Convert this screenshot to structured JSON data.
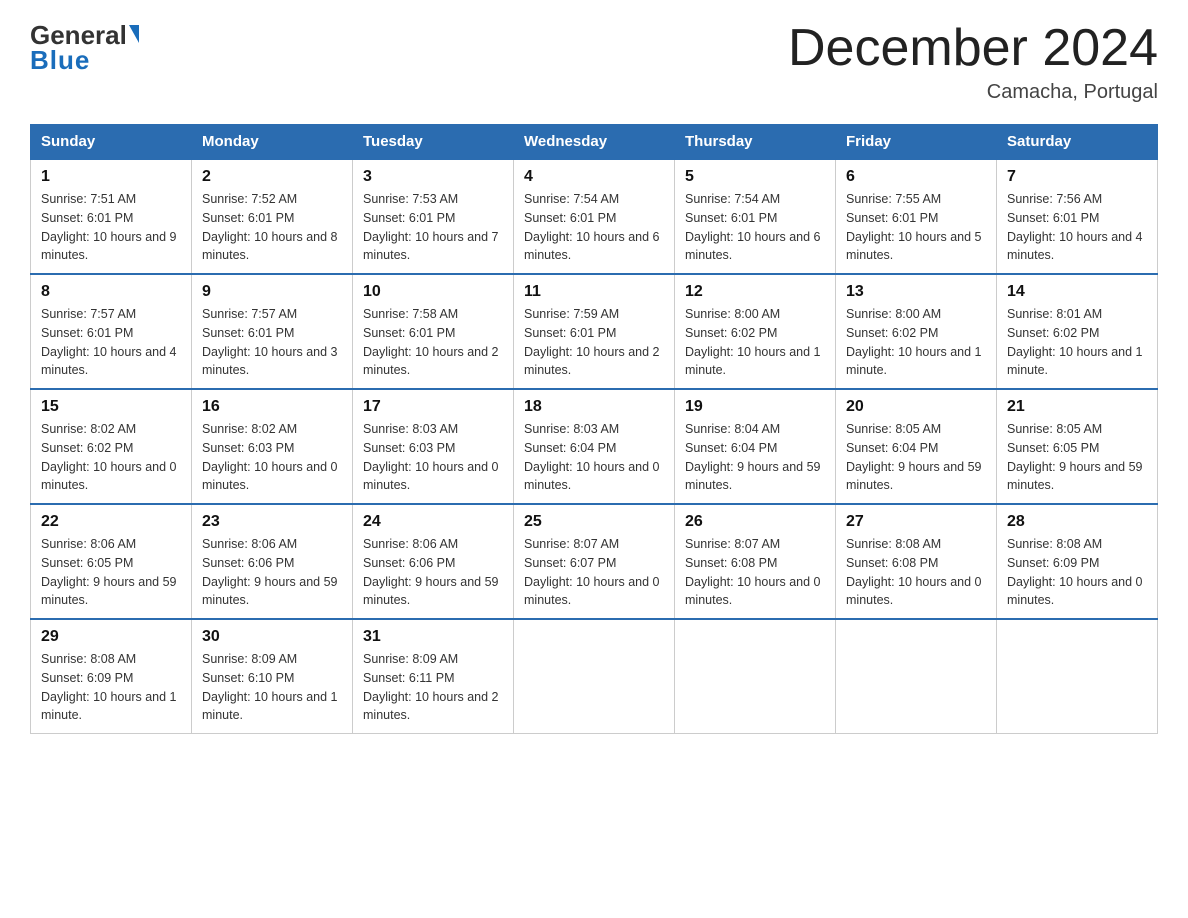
{
  "logo": {
    "general": "General",
    "blue": "Blue"
  },
  "header": {
    "title": "December 2024",
    "subtitle": "Camacha, Portugal"
  },
  "days_of_week": [
    "Sunday",
    "Monday",
    "Tuesday",
    "Wednesday",
    "Thursday",
    "Friday",
    "Saturday"
  ],
  "weeks": [
    [
      {
        "day": "1",
        "sunrise": "7:51 AM",
        "sunset": "6:01 PM",
        "daylight": "10 hours and 9 minutes."
      },
      {
        "day": "2",
        "sunrise": "7:52 AM",
        "sunset": "6:01 PM",
        "daylight": "10 hours and 8 minutes."
      },
      {
        "day": "3",
        "sunrise": "7:53 AM",
        "sunset": "6:01 PM",
        "daylight": "10 hours and 7 minutes."
      },
      {
        "day": "4",
        "sunrise": "7:54 AM",
        "sunset": "6:01 PM",
        "daylight": "10 hours and 6 minutes."
      },
      {
        "day": "5",
        "sunrise": "7:54 AM",
        "sunset": "6:01 PM",
        "daylight": "10 hours and 6 minutes."
      },
      {
        "day": "6",
        "sunrise": "7:55 AM",
        "sunset": "6:01 PM",
        "daylight": "10 hours and 5 minutes."
      },
      {
        "day": "7",
        "sunrise": "7:56 AM",
        "sunset": "6:01 PM",
        "daylight": "10 hours and 4 minutes."
      }
    ],
    [
      {
        "day": "8",
        "sunrise": "7:57 AM",
        "sunset": "6:01 PM",
        "daylight": "10 hours and 4 minutes."
      },
      {
        "day": "9",
        "sunrise": "7:57 AM",
        "sunset": "6:01 PM",
        "daylight": "10 hours and 3 minutes."
      },
      {
        "day": "10",
        "sunrise": "7:58 AM",
        "sunset": "6:01 PM",
        "daylight": "10 hours and 2 minutes."
      },
      {
        "day": "11",
        "sunrise": "7:59 AM",
        "sunset": "6:01 PM",
        "daylight": "10 hours and 2 minutes."
      },
      {
        "day": "12",
        "sunrise": "8:00 AM",
        "sunset": "6:02 PM",
        "daylight": "10 hours and 1 minute."
      },
      {
        "day": "13",
        "sunrise": "8:00 AM",
        "sunset": "6:02 PM",
        "daylight": "10 hours and 1 minute."
      },
      {
        "day": "14",
        "sunrise": "8:01 AM",
        "sunset": "6:02 PM",
        "daylight": "10 hours and 1 minute."
      }
    ],
    [
      {
        "day": "15",
        "sunrise": "8:02 AM",
        "sunset": "6:02 PM",
        "daylight": "10 hours and 0 minutes."
      },
      {
        "day": "16",
        "sunrise": "8:02 AM",
        "sunset": "6:03 PM",
        "daylight": "10 hours and 0 minutes."
      },
      {
        "day": "17",
        "sunrise": "8:03 AM",
        "sunset": "6:03 PM",
        "daylight": "10 hours and 0 minutes."
      },
      {
        "day": "18",
        "sunrise": "8:03 AM",
        "sunset": "6:04 PM",
        "daylight": "10 hours and 0 minutes."
      },
      {
        "day": "19",
        "sunrise": "8:04 AM",
        "sunset": "6:04 PM",
        "daylight": "9 hours and 59 minutes."
      },
      {
        "day": "20",
        "sunrise": "8:05 AM",
        "sunset": "6:04 PM",
        "daylight": "9 hours and 59 minutes."
      },
      {
        "day": "21",
        "sunrise": "8:05 AM",
        "sunset": "6:05 PM",
        "daylight": "9 hours and 59 minutes."
      }
    ],
    [
      {
        "day": "22",
        "sunrise": "8:06 AM",
        "sunset": "6:05 PM",
        "daylight": "9 hours and 59 minutes."
      },
      {
        "day": "23",
        "sunrise": "8:06 AM",
        "sunset": "6:06 PM",
        "daylight": "9 hours and 59 minutes."
      },
      {
        "day": "24",
        "sunrise": "8:06 AM",
        "sunset": "6:06 PM",
        "daylight": "9 hours and 59 minutes."
      },
      {
        "day": "25",
        "sunrise": "8:07 AM",
        "sunset": "6:07 PM",
        "daylight": "10 hours and 0 minutes."
      },
      {
        "day": "26",
        "sunrise": "8:07 AM",
        "sunset": "6:08 PM",
        "daylight": "10 hours and 0 minutes."
      },
      {
        "day": "27",
        "sunrise": "8:08 AM",
        "sunset": "6:08 PM",
        "daylight": "10 hours and 0 minutes."
      },
      {
        "day": "28",
        "sunrise": "8:08 AM",
        "sunset": "6:09 PM",
        "daylight": "10 hours and 0 minutes."
      }
    ],
    [
      {
        "day": "29",
        "sunrise": "8:08 AM",
        "sunset": "6:09 PM",
        "daylight": "10 hours and 1 minute."
      },
      {
        "day": "30",
        "sunrise": "8:09 AM",
        "sunset": "6:10 PM",
        "daylight": "10 hours and 1 minute."
      },
      {
        "day": "31",
        "sunrise": "8:09 AM",
        "sunset": "6:11 PM",
        "daylight": "10 hours and 2 minutes."
      },
      null,
      null,
      null,
      null
    ]
  ],
  "labels": {
    "sunrise": "Sunrise:",
    "sunset": "Sunset:",
    "daylight": "Daylight:"
  }
}
